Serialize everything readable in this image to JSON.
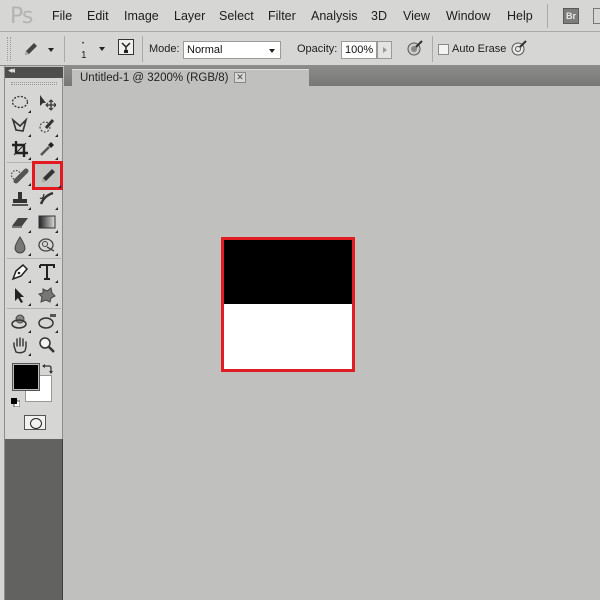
{
  "app": {
    "logo": "Ps"
  },
  "menu": [
    "File",
    "Edit",
    "Image",
    "Layer",
    "Select",
    "Filter",
    "Analysis",
    "3D",
    "View",
    "Window",
    "Help"
  ],
  "bridge_button": "Br",
  "options_bar": {
    "tool_icon": "pencil-icon",
    "brush_size": "1",
    "mode_label": "Mode:",
    "mode_value": "Normal",
    "opacity_label": "Opacity:",
    "opacity_value": "100%",
    "auto_erase_label": "Auto Erase",
    "auto_erase_checked": false
  },
  "document": {
    "tab_title": "Untitled-1 @ 3200% (RGB/8)",
    "close_glyph": "✕",
    "zoom": "3200%",
    "color_mode": "RGB/8"
  },
  "toolbox": {
    "collapse_glyph": "◂◂",
    "selected_tool": "pencil",
    "tools": [
      "marquee",
      "move",
      "polygonal-lasso",
      "quick-selection",
      "crop",
      "eyedropper",
      "spot-healing",
      "pencil",
      "clone-stamp",
      "history-brush",
      "eraser",
      "gradient",
      "blur",
      "dodge",
      "pen",
      "type",
      "path-selection",
      "custom-shape",
      "3d-rotate",
      "3d-orbit",
      "hand",
      "zoom"
    ],
    "foreground_color": "#000000",
    "background_color": "#ffffff"
  },
  "canvas": {
    "top_color": "#000000",
    "bottom_color": "#ffffff",
    "highlight_color": "#e11d24"
  }
}
